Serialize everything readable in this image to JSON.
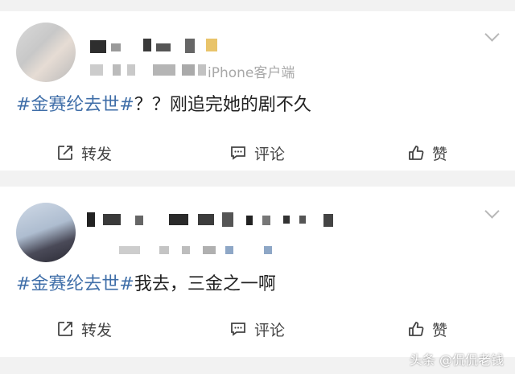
{
  "posts": [
    {
      "meta": "iPhone客户端",
      "content_tag": "#金赛纶去世#",
      "content_text": "？？刚追完她的剧不久",
      "actions": {
        "repost": "转发",
        "comment": "评论",
        "like": "赞"
      }
    },
    {
      "content_tag": "#金赛纶去世#",
      "content_text": "我去，三金之一啊",
      "actions": {
        "repost": "转发",
        "comment": "评论",
        "like": "赞"
      }
    }
  ],
  "watermark": "头条 @侃侃老钱",
  "colors": {
    "hashtag": "#3f6ea8",
    "text": "#222222",
    "meta": "#a8a8a8",
    "background": "#f2f2f2"
  },
  "icons": [
    "share-icon",
    "comment-icon",
    "thumbs-up-icon",
    "chevron-down-icon"
  ]
}
